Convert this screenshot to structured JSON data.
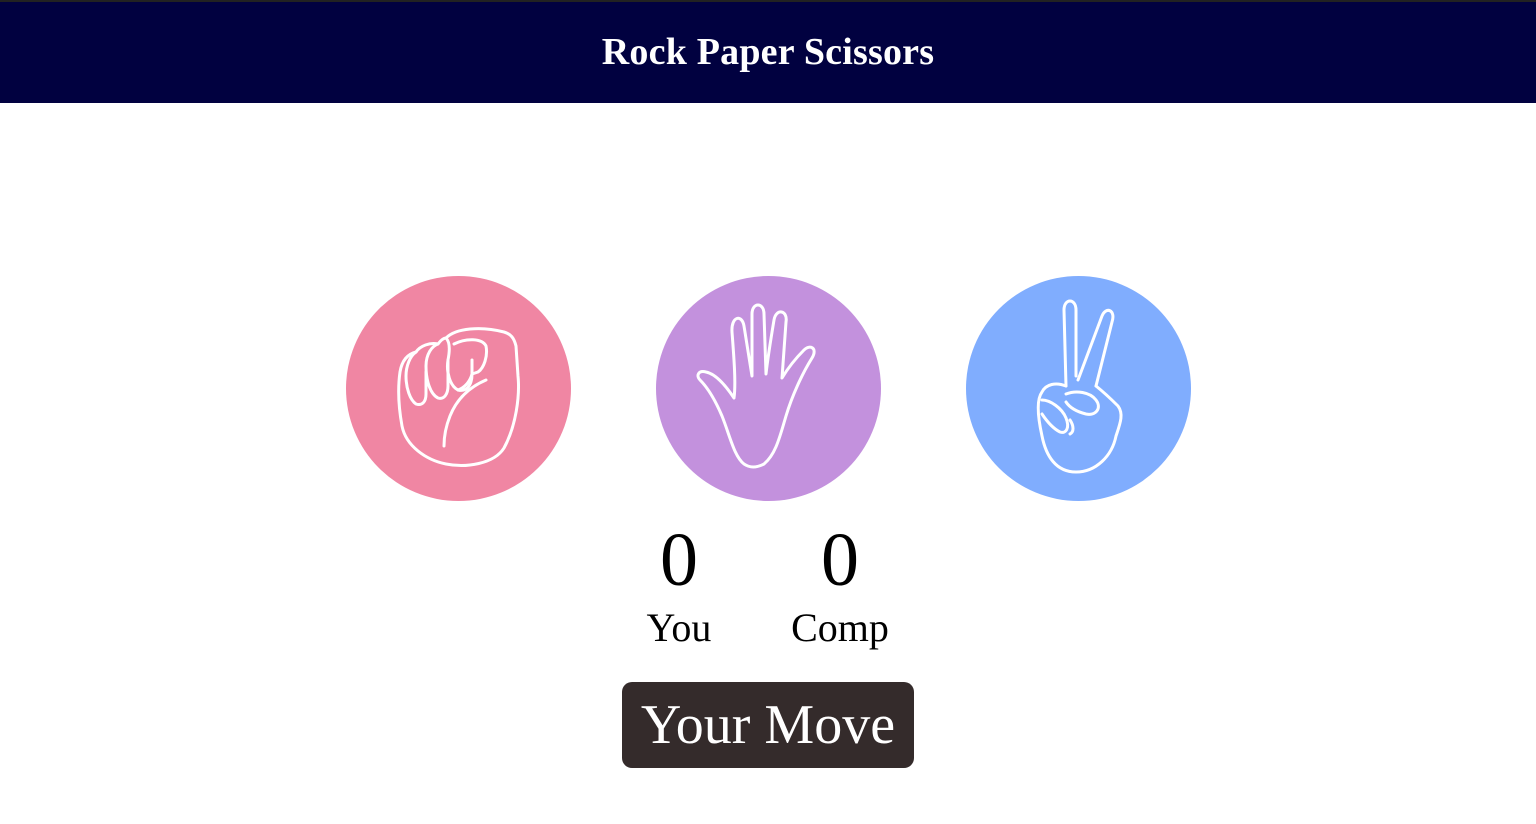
{
  "header": {
    "title": "Rock Paper Scissors",
    "background": "#010140"
  },
  "choices": [
    {
      "id": "rock",
      "icon": "fist-icon",
      "color": "#f086a3"
    },
    {
      "id": "paper",
      "icon": "open-hand-icon",
      "color": "#c391dd"
    },
    {
      "id": "scissors",
      "icon": "peace-sign-icon",
      "color": "#80adfe"
    }
  ],
  "scores": {
    "user": {
      "value": "0",
      "label": "You"
    },
    "comp": {
      "value": "0",
      "label": "Comp"
    }
  },
  "message": {
    "text": "Your Move",
    "background": "#342b2b"
  }
}
